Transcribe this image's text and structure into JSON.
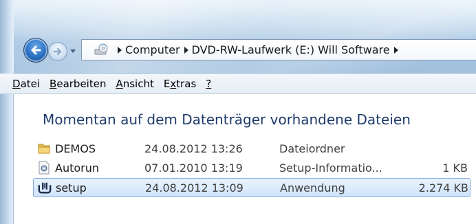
{
  "address": {
    "crumbs": [
      "Computer",
      "DVD-RW-Laufwerk (E:) Will Software"
    ]
  },
  "menu": {
    "items": [
      {
        "label_ul": "D",
        "label_rest": "atei"
      },
      {
        "label_ul": "B",
        "label_rest": "earbeiten"
      },
      {
        "label_ul": "A",
        "label_rest": "nsicht"
      },
      {
        "label_pre": "E",
        "label_ul": "x",
        "label_rest": "tras"
      },
      {
        "label_ul": "?",
        "label_rest": ""
      }
    ]
  },
  "content": {
    "heading": "Momentan auf dem Datenträger vorhandene Dateien",
    "files": [
      {
        "name": "DEMOS",
        "date": "24.08.2012 13:26",
        "type": "Dateiordner",
        "size": "",
        "icon": "folder-icon"
      },
      {
        "name": "Autorun",
        "date": "07.01.2010 13:19",
        "type": "Setup-Informatio...",
        "size": "1 KB",
        "icon": "setup-information-icon"
      },
      {
        "name": "setup",
        "date": "24.08.2012 13:09",
        "type": "Anwendung",
        "size": "2.274 KB",
        "icon": "application-icon",
        "selected": true
      }
    ]
  },
  "colors": {
    "heading": "#1e3a6b",
    "selection_bg": "#cfe4fb",
    "selection_border": "#84acdd",
    "glass": "#b9d3ea"
  }
}
